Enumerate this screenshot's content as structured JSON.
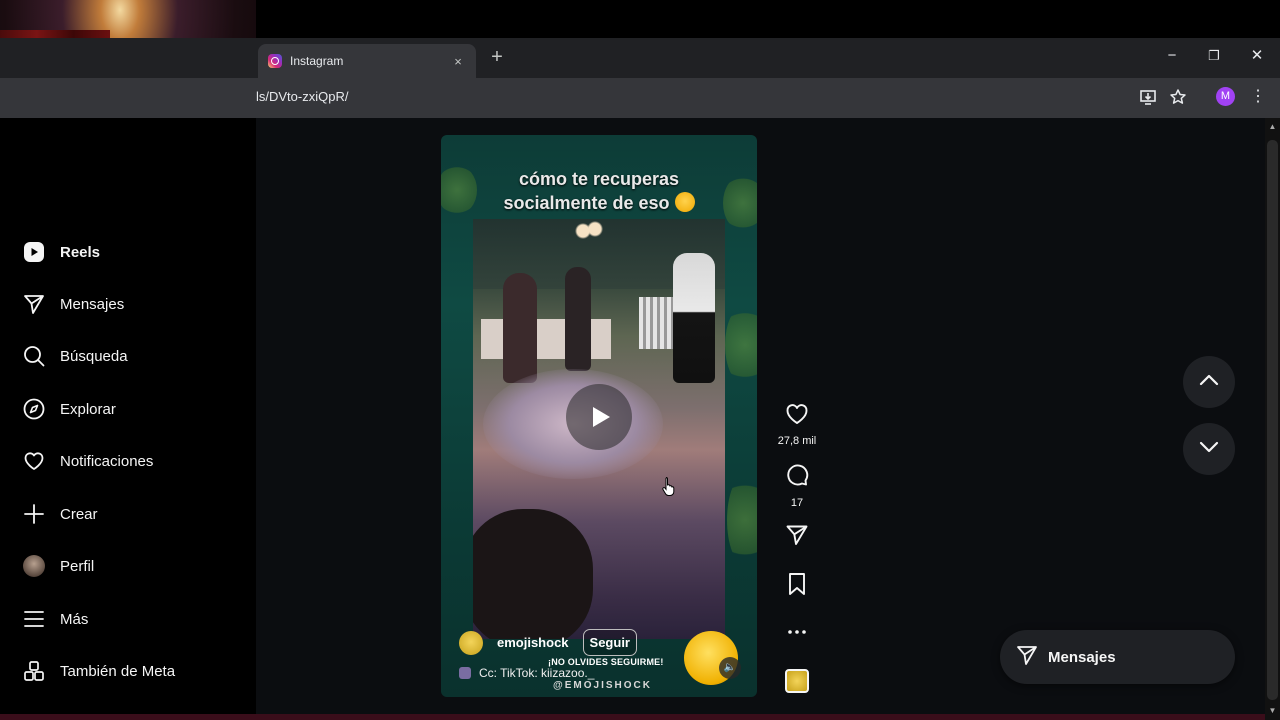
{
  "browser": {
    "tab_title": "Instagram",
    "tab_close": "×",
    "new_tab": "+",
    "url": "ls/DVto-zxiQpR/",
    "profile_initial": "M",
    "window_controls": {
      "minimize": "−",
      "restore": "❐",
      "close": "✕"
    },
    "menu": "⋮"
  },
  "sidebar": {
    "items": [
      {
        "label": "Reels",
        "icon": "reels-icon",
        "active": true
      },
      {
        "label": "Mensajes",
        "icon": "send-icon"
      },
      {
        "label": "Búsqueda",
        "icon": "search-icon"
      },
      {
        "label": "Explorar",
        "icon": "compass-icon"
      },
      {
        "label": "Notificaciones",
        "icon": "heart-icon"
      },
      {
        "label": "Crear",
        "icon": "plus-icon"
      },
      {
        "label": "Perfil",
        "icon": "avatar"
      },
      {
        "label": "Más",
        "icon": "menu-icon"
      },
      {
        "label": "También de Meta",
        "icon": "meta-apps-icon"
      }
    ]
  },
  "reel": {
    "caption_line1": "cómo te recuperas",
    "caption_line2": "socialmente de eso",
    "username": "emojishock",
    "follow_label": "Seguir",
    "subtitle": "Cc: TikTok: kiizazoo._",
    "watermark_top": "¡NO OLVIDES SEGUIRME!",
    "watermark_bottom": "@EMOJISHOCK",
    "mute_icon": "🔈"
  },
  "actions": {
    "likes": "27,8 mil",
    "comments": "17"
  },
  "messages_pill": {
    "label": "Mensajes"
  },
  "colors": {
    "accent_profile": "#a142f4",
    "reel_bg": "#0d3c37",
    "page_bg": "#0b0d10"
  }
}
